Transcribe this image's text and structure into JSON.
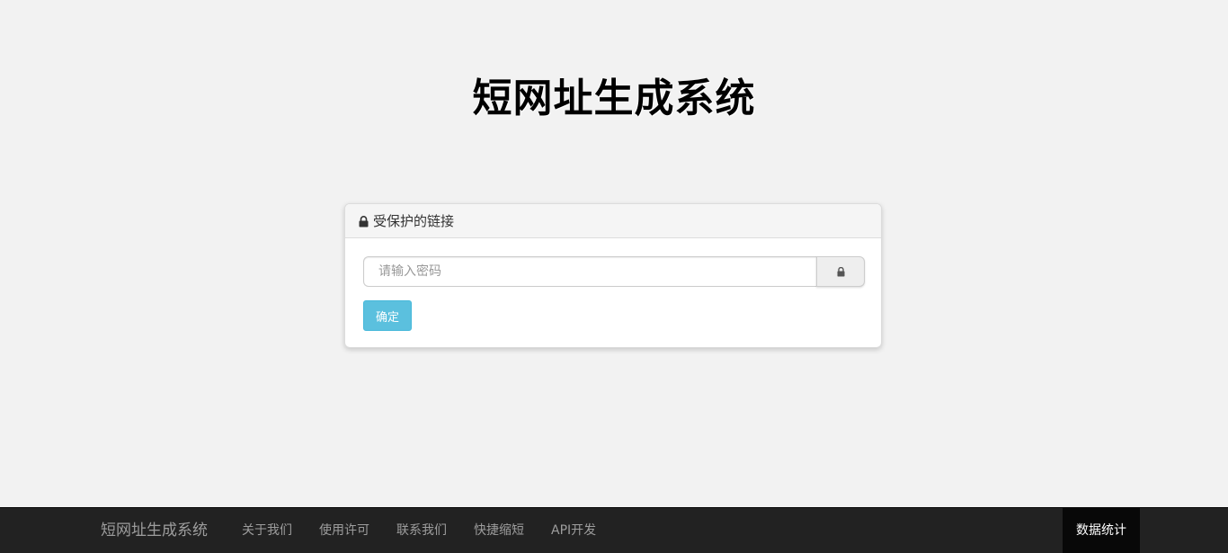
{
  "header": {
    "title": "短网址生成系统"
  },
  "panel": {
    "heading": "受保护的链接",
    "heading_icon": "lock-icon",
    "password_input": {
      "placeholder": "请输入密码",
      "value": ""
    },
    "addon_icon": "lock-icon",
    "confirm_label": "确定",
    "confirm_color": "#5bc0de"
  },
  "navbar": {
    "brand": "短网址生成系统",
    "links": [
      {
        "label": "关于我们"
      },
      {
        "label": "使用许可"
      },
      {
        "label": "联系我们"
      },
      {
        "label": "快捷缩短"
      },
      {
        "label": "API开发"
      }
    ],
    "stats_label": "数据统计",
    "background": "#222222"
  }
}
